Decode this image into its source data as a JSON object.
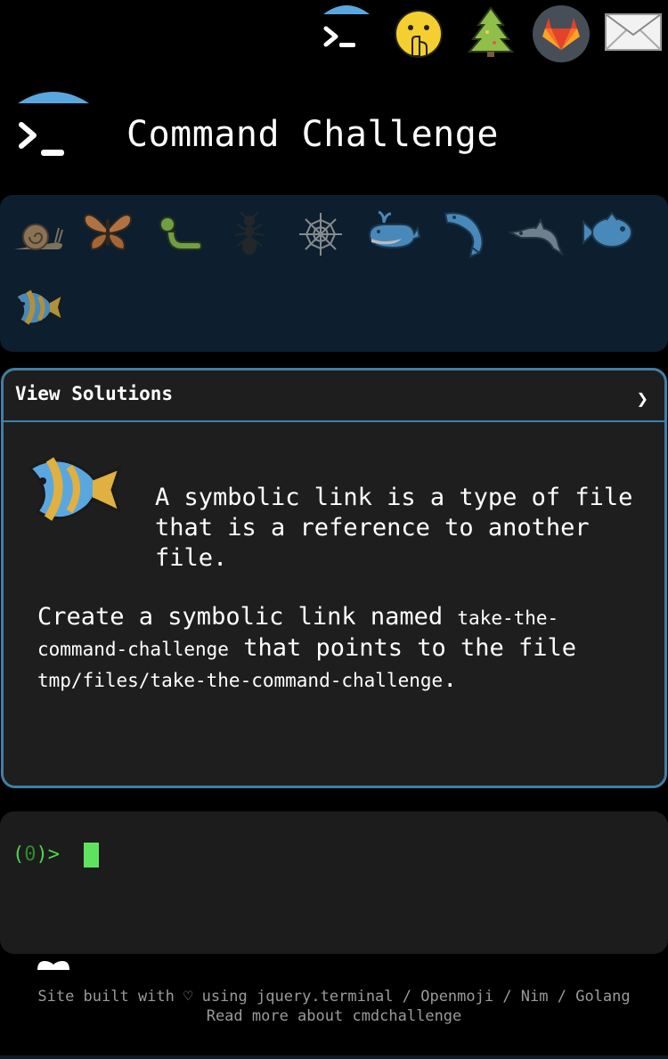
{
  "topbar": {
    "icons": [
      "terminal-umbrella-icon",
      "shushing-face-icon",
      "christmas-tree-icon",
      "gitlab-fox-icon",
      "envelope-icon"
    ]
  },
  "header": {
    "logo": "terminal-umbrella-logo",
    "title": "Command Challenge"
  },
  "tray": {
    "icons": [
      "snail-icon",
      "butterfly-icon",
      "caterpillar-icon",
      "ant-icon",
      "spider-web-icon",
      "whale-icon",
      "spouting-whale-icon",
      "dolphin-icon",
      "fish-icon",
      "tropical-fish-icon"
    ]
  },
  "challenge": {
    "toggle_label": "View Solutions",
    "chevron": "❯",
    "icon": "tropical-fish-icon",
    "intro": "A symbolic link is a type of file that is a reference to another file.",
    "task_prefix": "Create a symbolic link named ",
    "task_code1": "take-the-command-challenge",
    "task_middle": " that points to the file ",
    "task_code2": "tmp/files/take-the-command-challenge",
    "task_suffix": "."
  },
  "terminal": {
    "prompt_open": "(",
    "prompt_count": "0",
    "prompt_close": ")>"
  },
  "footer": {
    "line1": "Site built with ♡ using jquery.terminal / Openmoji / Nim / Golang",
    "line2": "Read more about cmdchallenge"
  },
  "colors": {
    "background": "#000000",
    "tray": "#0d1f2e",
    "panel": "#1e1e1e",
    "panel_border": "#3f7fa6",
    "terminal": "#1c1c1c",
    "prompt_green": "#4bd84b"
  }
}
